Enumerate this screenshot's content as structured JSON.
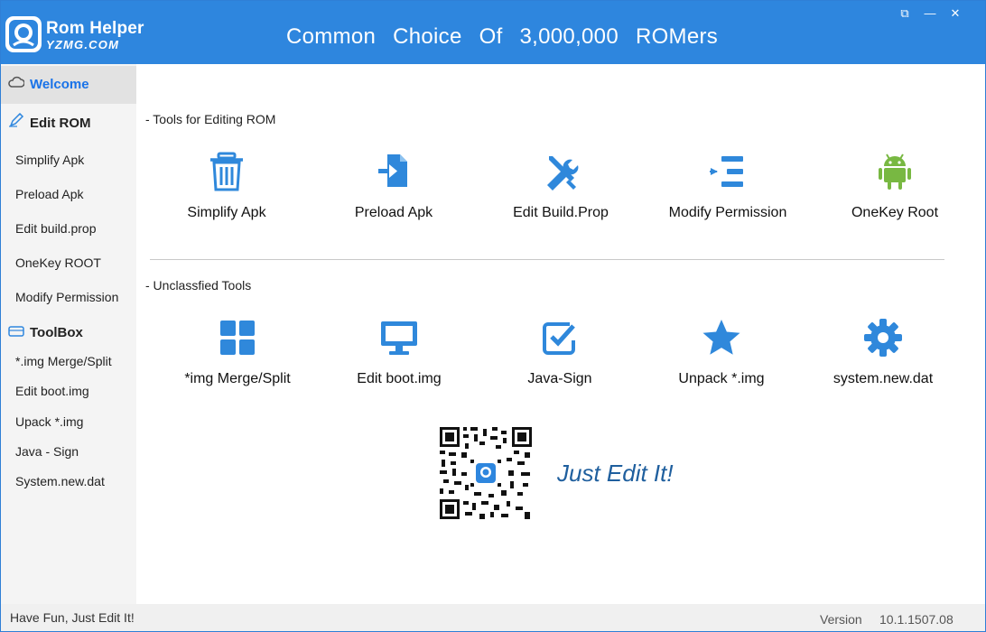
{
  "app": {
    "name": "Rom Helper",
    "site": "YZMG.COM",
    "slogan": "Common Choice Of 3,000,000 ROMers"
  },
  "window_controls": [
    "⧉",
    "—",
    "✕"
  ],
  "sidebar": {
    "welcome": "Welcome",
    "edit_rom_header": "Edit ROM",
    "edit_rom_items": [
      "Simplify Apk",
      "Preload Apk",
      "Edit build.prop",
      "OneKey ROOT",
      "Modify Permission"
    ],
    "toolbox_header": "ToolBox",
    "toolbox_items": [
      "*.img Merge/Split",
      "Edit boot.img",
      "Upack  *.img",
      "Java - Sign",
      "System.new.dat"
    ]
  },
  "main": {
    "section1_title": "- Tools for Editing ROM",
    "section1_tools": [
      {
        "label": "Simplify Apk",
        "icon": "trash-icon"
      },
      {
        "label": "Preload Apk",
        "icon": "file-import-icon"
      },
      {
        "label": "Edit Build.Prop",
        "icon": "wrench-screwdriver-icon"
      },
      {
        "label": "Modify Permission",
        "icon": "indent-list-icon"
      },
      {
        "label": "OneKey Root",
        "icon": "android-icon"
      }
    ],
    "section2_title": "- Unclassfied Tools",
    "section2_tools": [
      {
        "label": "*img Merge/Split",
        "icon": "grid-icon"
      },
      {
        "label": "Edit boot.img",
        "icon": "monitor-icon"
      },
      {
        "label": "Java-Sign",
        "icon": "checkbox-icon"
      },
      {
        "label": "Unpack *.img",
        "icon": "star-icon"
      },
      {
        "label": "system.new.dat",
        "icon": "gear-icon"
      }
    ],
    "tagline": "Just Edit It!"
  },
  "status": {
    "left": "Have Fun, Just Edit It!",
    "version_label": "Version",
    "version": "10.1.1507.08"
  },
  "colors": {
    "titlebar": "#2e86de",
    "icon_blue": "#2f88db",
    "android_green": "#78b842",
    "accent_text": "#1a73e8"
  }
}
